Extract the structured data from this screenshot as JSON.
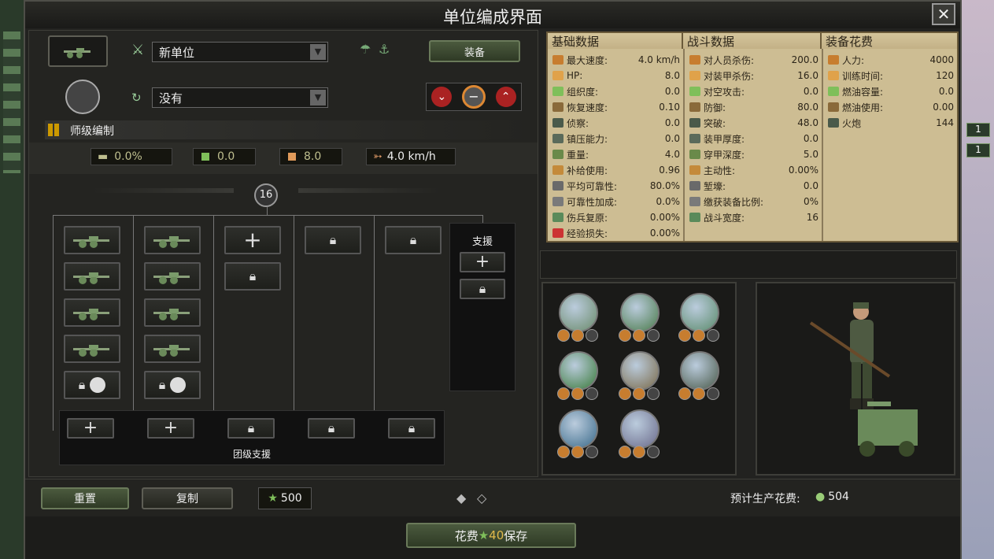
{
  "window": {
    "title": "单位编成界面",
    "close_icon": "close-icon"
  },
  "header": {
    "unit_name": "新单位",
    "equip_label": "装备",
    "template_value": "没有",
    "division_section": "师级编制"
  },
  "summary": {
    "org_pct": "0.0%",
    "hp": "0.0",
    "supply": "8.0",
    "speed": "4.0 km/h",
    "width_badge": "16"
  },
  "regiments": {
    "support_label": "支援",
    "regiment_support_label": "团级支援"
  },
  "stats": {
    "col1_title": "基础数据",
    "col2_title": "战斗数据",
    "col3_title": "装备花费",
    "basic": [
      {
        "label": "最大速度:",
        "value": "4.0 km/h"
      },
      {
        "label": "HP:",
        "value": "8.0"
      },
      {
        "label": "组织度:",
        "value": "0.0"
      },
      {
        "label": "恢复速度:",
        "value": "0.10"
      },
      {
        "label": "侦察:",
        "value": "0.0"
      },
      {
        "label": "镇压能力:",
        "value": "0.0"
      },
      {
        "label": "重量:",
        "value": "4.0"
      },
      {
        "label": "补给使用:",
        "value": "0.96"
      },
      {
        "label": "平均可靠性:",
        "value": "80.0%"
      },
      {
        "label": "可靠性加成:",
        "value": "0.0%"
      },
      {
        "label": "伤兵复原:",
        "value": "0.00%"
      },
      {
        "label": "经验损失:",
        "value": "0.00%"
      }
    ],
    "combat": [
      {
        "label": "对人员杀伤:",
        "value": "200.0"
      },
      {
        "label": "对装甲杀伤:",
        "value": "16.0"
      },
      {
        "label": "对空攻击:",
        "value": "0.0"
      },
      {
        "label": "防御:",
        "value": "80.0"
      },
      {
        "label": "突破:",
        "value": "48.0"
      },
      {
        "label": "装甲厚度:",
        "value": "0.0"
      },
      {
        "label": "穿甲深度:",
        "value": "5.0"
      },
      {
        "label": "主动性:",
        "value": "0.00%"
      },
      {
        "label": "堑壕:",
        "value": "0.0"
      },
      {
        "label": "缴获装备比例:",
        "value": "0%"
      },
      {
        "label": "战斗宽度:",
        "value": "16"
      }
    ],
    "cost": [
      {
        "label": "人力:",
        "value": "4000"
      },
      {
        "label": "训练时间:",
        "value": "120"
      },
      {
        "label": "燃油容量:",
        "value": "0.0"
      },
      {
        "label": "燃油使用:",
        "value": "0.00"
      },
      {
        "label": "火炮",
        "value": "144"
      }
    ]
  },
  "footer": {
    "reset": "重置",
    "copy": "复制",
    "xp_cost": "500",
    "production_cost_label": "预计生产花费:",
    "production_cost_value": "504",
    "save_cost_prefix": "花费",
    "save_cost_value": "40",
    "save_label": "保存"
  },
  "side": {
    "badge1": "1",
    "badge2": "1"
  },
  "colors": {
    "accent_green": "#7fbf5a",
    "parchment": "#cdbd93",
    "gold": "#e0b84a"
  }
}
